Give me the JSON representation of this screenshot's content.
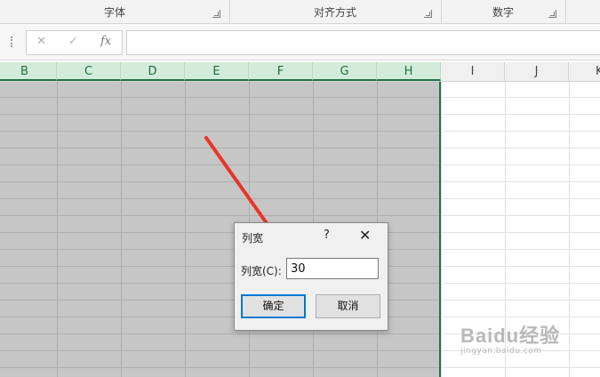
{
  "ribbon": {
    "groups": [
      {
        "label": "字体"
      },
      {
        "label": "对齐方式"
      },
      {
        "label": "数字"
      }
    ]
  },
  "formula_bar": {
    "cancel_glyph": "✕",
    "confirm_glyph": "✓",
    "fx_label": "fx",
    "value": ""
  },
  "columns": [
    "B",
    "C",
    "D",
    "E",
    "F",
    "G",
    "H",
    "I",
    "J",
    "K"
  ],
  "selected_columns": [
    "B",
    "C",
    "D",
    "E",
    "F",
    "G",
    "H"
  ],
  "dialog": {
    "title": "列宽",
    "help": "?",
    "close": "✕",
    "field_label": "列宽(C):",
    "field_value": "30",
    "ok_label": "确定",
    "cancel_label": "取消"
  },
  "watermark": {
    "brand": "Baidu经验",
    "url": "jingyan.baidu.com"
  },
  "colors": {
    "accent": "#217346",
    "selection": "#c6c6c6",
    "arrow": "#e8352a"
  }
}
